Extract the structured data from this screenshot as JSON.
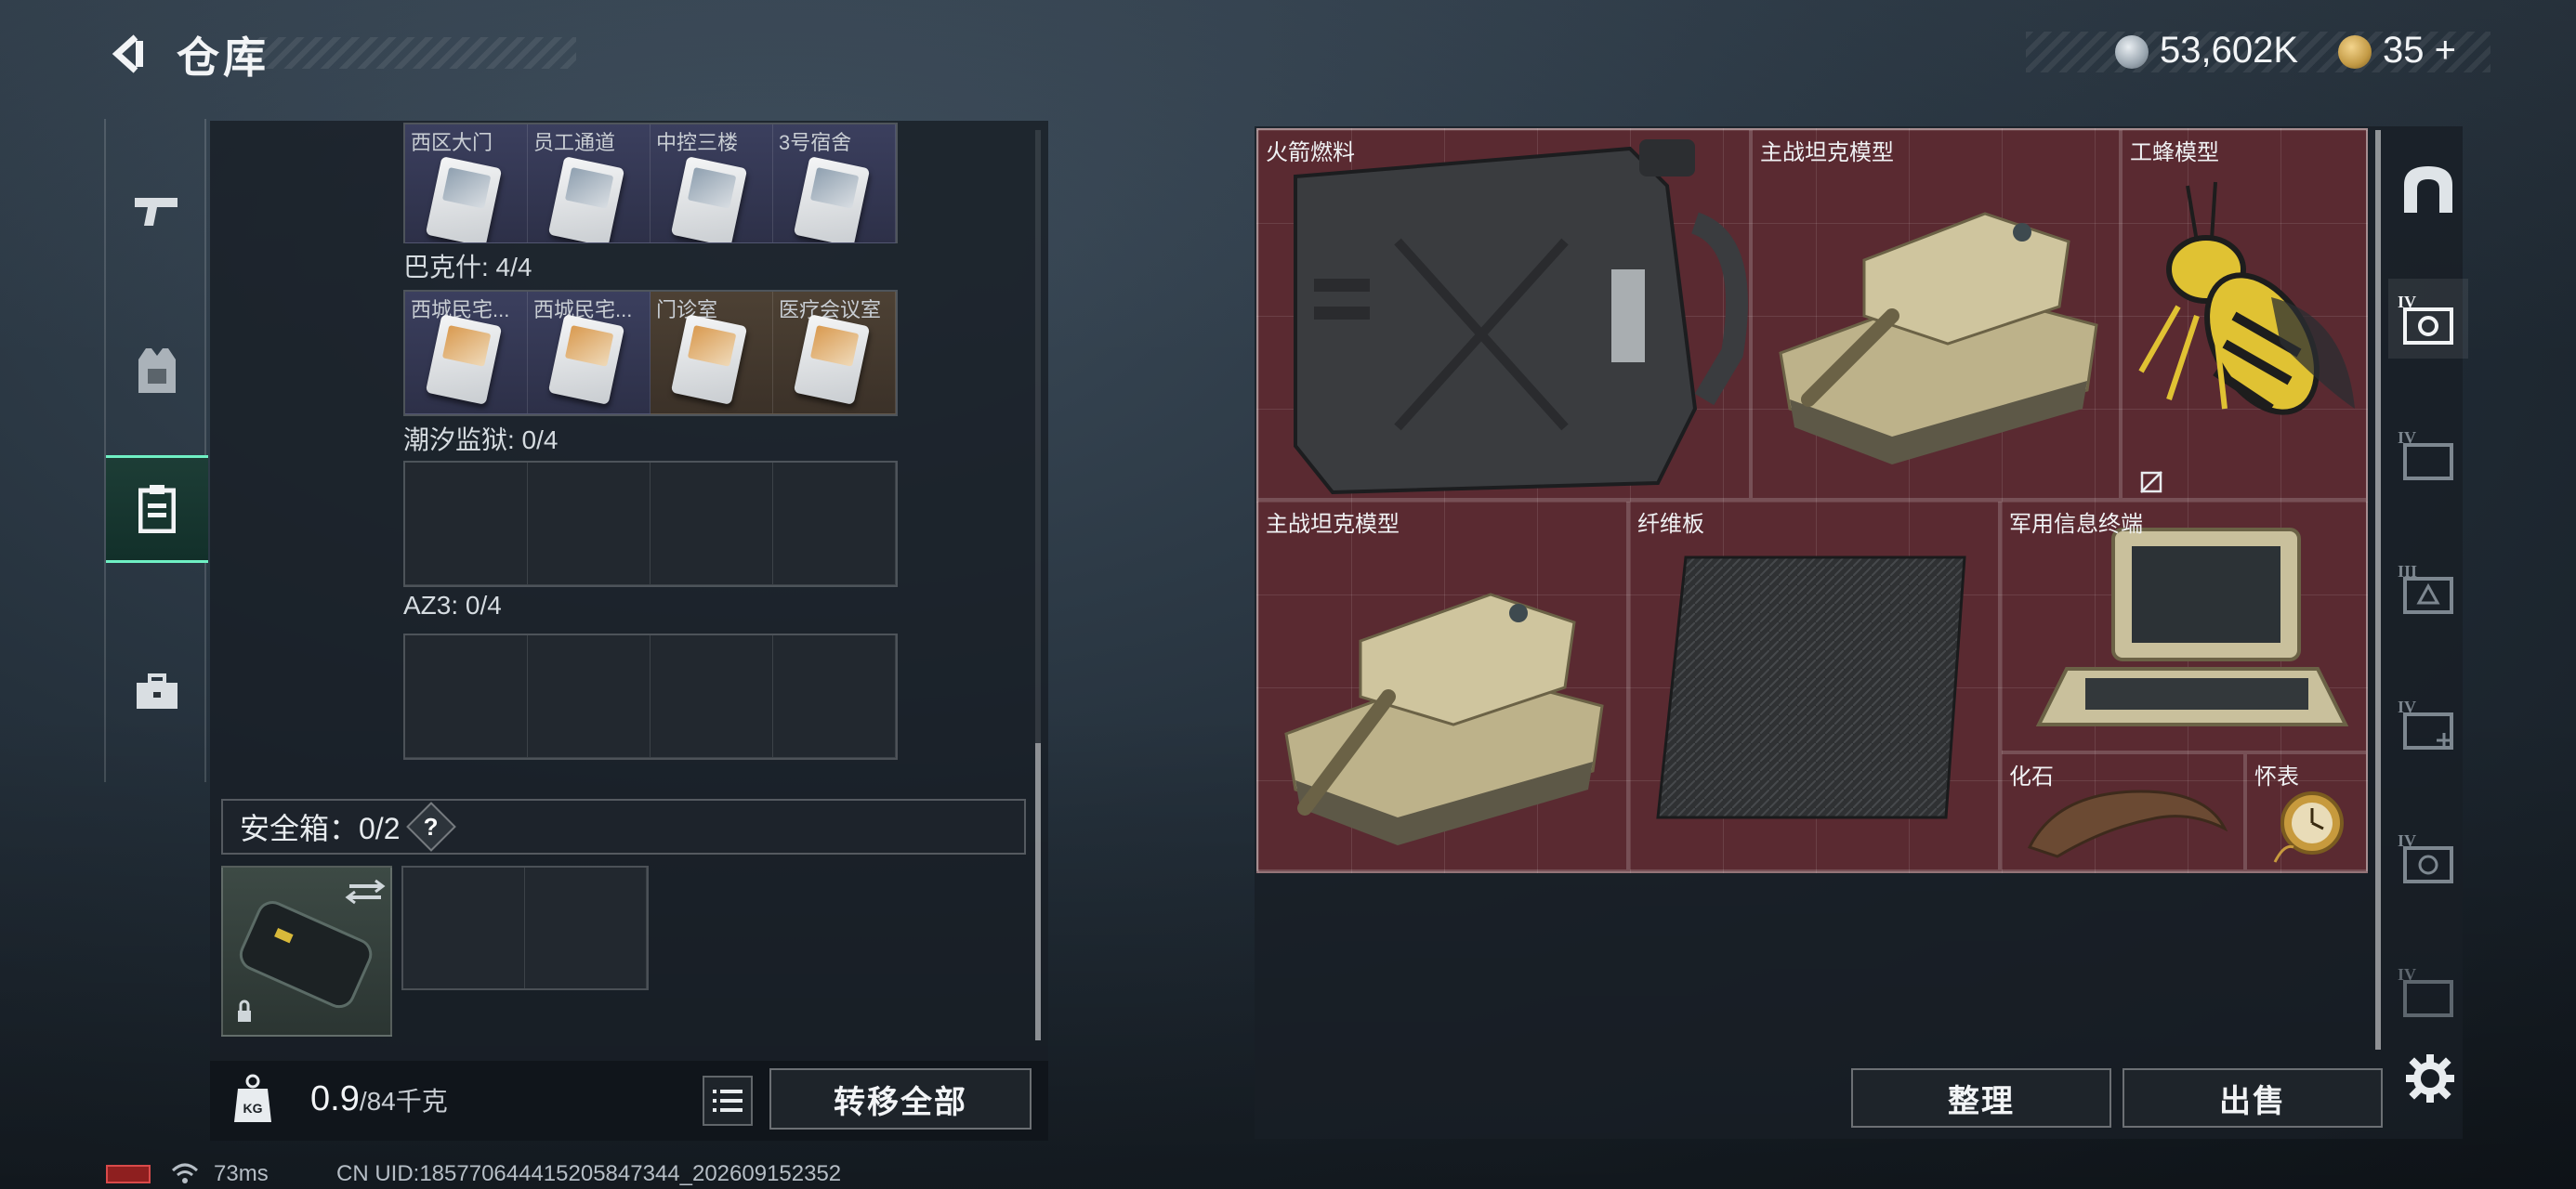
{
  "header": {
    "title": "仓库",
    "currency_value": "53,602K",
    "token_value": "35",
    "token_plus": "+"
  },
  "left_rail": {
    "items": [
      {
        "name": "weapons",
        "icon": "pistol-icon"
      },
      {
        "name": "armor",
        "icon": "vest-icon"
      },
      {
        "name": "keycards",
        "icon": "keycard-holder-icon",
        "active": true
      },
      {
        "name": "tools",
        "icon": "toolbox-icon"
      }
    ]
  },
  "key_sections": [
    {
      "label": "",
      "slots": [
        {
          "name": "西区大门",
          "bound": false,
          "tone": "blue"
        },
        {
          "name": "员工通道",
          "bound": true,
          "tone": "blue"
        },
        {
          "name": "中控三楼",
          "bound": false,
          "tone": "blue"
        },
        {
          "name": "3号宿舍",
          "bound": false,
          "tone": "blue"
        }
      ]
    },
    {
      "label": "巴克什: 4/4",
      "slots": [
        {
          "name": "西城民宅...",
          "bound": false,
          "tone": "blue"
        },
        {
          "name": "西城民宅...",
          "bound": true,
          "tone": "blue"
        },
        {
          "name": "门诊室",
          "bound": false,
          "tone": "gold"
        },
        {
          "name": "医疗会议室",
          "bound": false,
          "tone": "gold"
        }
      ]
    },
    {
      "label": "潮汐监狱: 0/4",
      "slots": []
    },
    {
      "label": "AZ3: 0/4",
      "slots": []
    }
  ],
  "safe_box": {
    "title": "安全箱：0/2",
    "help": "?"
  },
  "weight": {
    "current": "0.9",
    "max": "/84千克",
    "unit_badge": "KG"
  },
  "buttons": {
    "transfer_all": "转移全部",
    "organize": "整理",
    "sell": "出售"
  },
  "loot_items": [
    {
      "name": "火箭燃料",
      "kind": "jerrycan"
    },
    {
      "name": "主战坦克模型",
      "kind": "tank"
    },
    {
      "name": "工蜂模型",
      "kind": "wasp",
      "bound": true
    },
    {
      "name": "主战坦克模型",
      "kind": "tank"
    },
    {
      "name": "纤维板",
      "kind": "fiber"
    },
    {
      "name": "军用信息终端",
      "kind": "terminal"
    },
    {
      "name": "化石",
      "kind": "fossil"
    },
    {
      "name": "怀表",
      "kind": "pocketwatch"
    }
  ],
  "right_rail": [
    {
      "label": "",
      "icon": "home-arch-icon"
    },
    {
      "label": "IV",
      "icon": "storage-case-icon"
    },
    {
      "label": "IV",
      "icon": "storage-case-icon"
    },
    {
      "label": "III",
      "icon": "storage-case-icon"
    },
    {
      "label": "IV",
      "icon": "storage-case-icon"
    },
    {
      "label": "IV",
      "icon": "storage-case-icon"
    },
    {
      "label": "IV",
      "icon": "storage-case-icon"
    }
  ],
  "status": {
    "ping": "73ms",
    "uid": "CN UID:185770644415205847344_202609152352"
  }
}
